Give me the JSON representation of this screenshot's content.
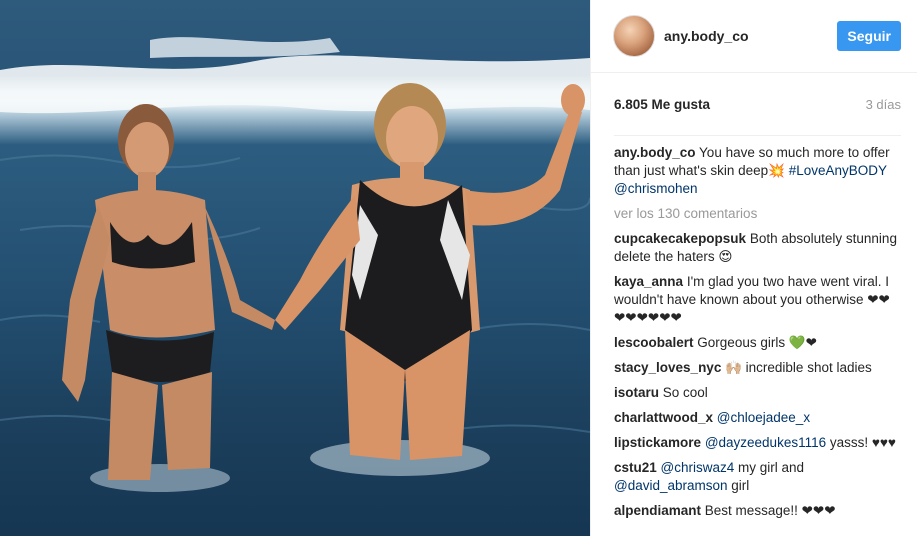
{
  "post": {
    "username": "any.body_co",
    "follow_label": "Seguir",
    "likes": "6.805 Me gusta",
    "time_ago": "3 días",
    "caption": {
      "user": "any.body_co",
      "text": "You have so much more to offer than just what's skin deep",
      "emoji": "💥",
      "hashtag": "#LoveAnyBODY",
      "mention": "@chrismohen"
    },
    "view_all": "ver los 130 comentarios"
  },
  "comments": [
    {
      "user": "cupcakecakepopsuk",
      "text": "Both absolutely stunning delete the haters 😍"
    },
    {
      "user": "kaya_anna",
      "text": "I'm glad you two have went viral. I wouldn't have known about you otherwise ❤❤❤❤❤❤❤❤"
    },
    {
      "user": "lescoobalert",
      "text": "Gorgeous girls 💚❤"
    },
    {
      "user": "stacy_loves_nyc",
      "text": "🙌🏼 incredible shot ladies"
    },
    {
      "user": "isotaru",
      "text": "So cool"
    },
    {
      "user": "charlattwood_x",
      "mention": "@chloejadee_x"
    },
    {
      "user": "lipstickamore",
      "mention": "@dayzeedukes1116",
      "text": "yasss! ♥♥♥"
    },
    {
      "user": "cstu21",
      "mention": "@chriswaz4",
      "text": "my girl and",
      "mention2": "@david_abramson",
      "text2": "girl"
    },
    {
      "user": "alpendiamant",
      "text": "Best message!! ❤❤❤"
    }
  ],
  "colors": {
    "accent": "#3897f0",
    "link": "#003569",
    "muted": "#999999"
  }
}
